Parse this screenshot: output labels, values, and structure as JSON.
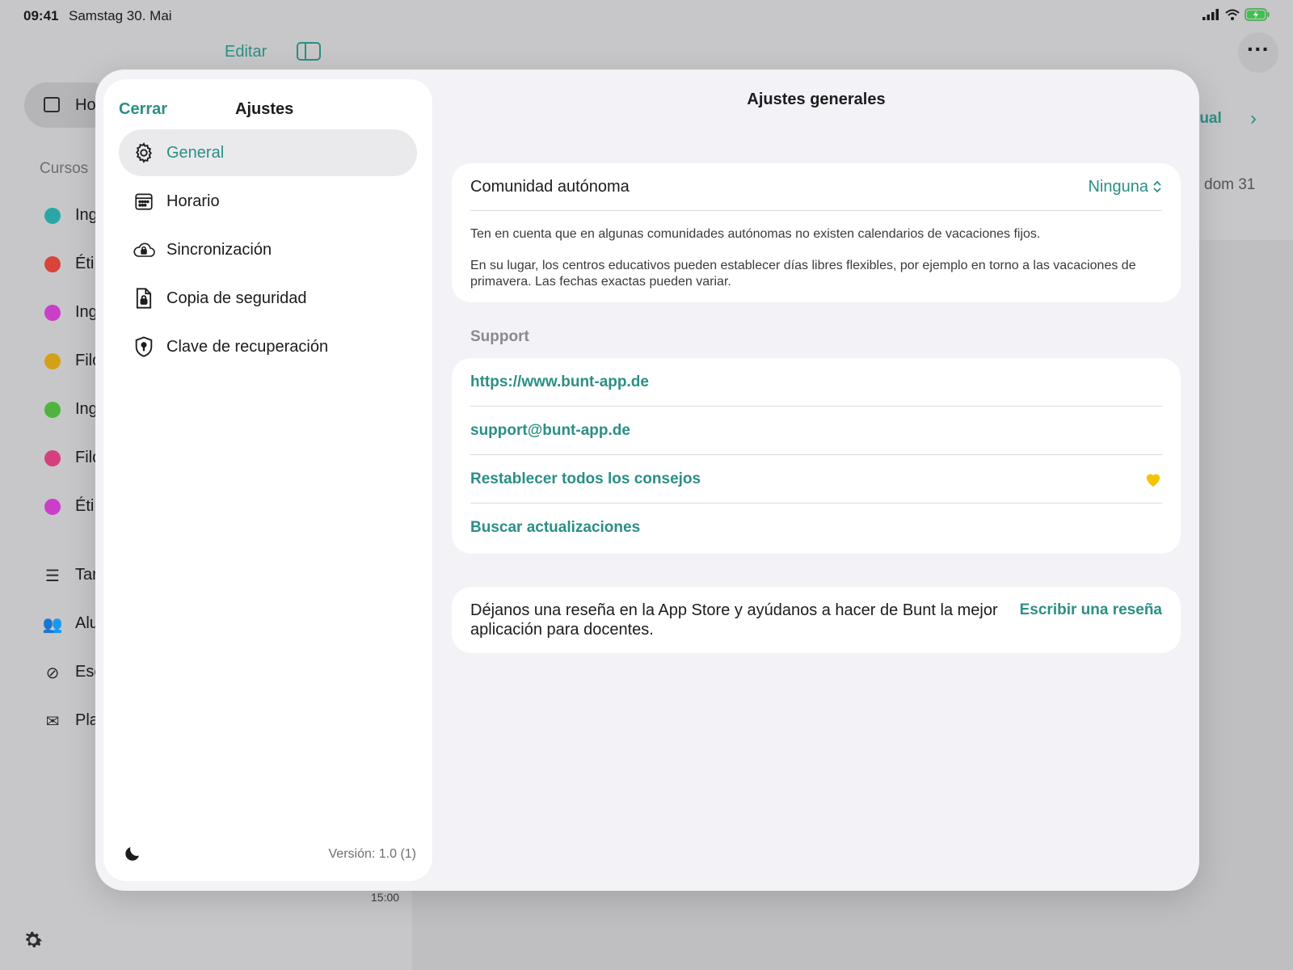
{
  "status_bar": {
    "time": "09:41",
    "date": "Samstag 30. Mai"
  },
  "background": {
    "edit_label": "Editar",
    "home_label": "Ho",
    "section_label": "Cursos",
    "courses": [
      {
        "label": "Ing",
        "color": "#2ba6a6"
      },
      {
        "label": "Éti",
        "color": "#d8443a"
      },
      {
        "label": "Ing",
        "color": "#c93fc9"
      },
      {
        "label": "Filo",
        "color": "#d4a018"
      },
      {
        "label": "Ing",
        "color": "#4fb33f"
      },
      {
        "label": "Filo",
        "color": "#d63f7d"
      },
      {
        "label": "Éti",
        "color": "#c93fc9"
      }
    ],
    "nav_items": [
      {
        "label": "Tar",
        "icon": "checklist-icon"
      },
      {
        "label": "Alu",
        "icon": "people-icon"
      },
      {
        "label": "Esc",
        "icon": "clock-slash-icon"
      },
      {
        "label": "Pla",
        "icon": "envelope-icon"
      }
    ],
    "actual_label": "tual",
    "day_label": "dom 31",
    "time_label": "15:00"
  },
  "settings": {
    "close_label": "Cerrar",
    "title": "Ajustes",
    "menu": [
      {
        "label": "General",
        "icon": "gear-icon",
        "active": true
      },
      {
        "label": "Horario",
        "icon": "calendar-icon",
        "active": false
      },
      {
        "label": "Sincronización",
        "icon": "cloud-lock-icon",
        "active": false
      },
      {
        "label": "Copia de seguridad",
        "icon": "doc-lock-icon",
        "active": false
      },
      {
        "label": "Clave de recuperación",
        "icon": "shield-key-icon",
        "active": false
      }
    ],
    "version": "Versión: 1.0 (1)"
  },
  "general": {
    "title": "Ajustes generales",
    "region_label": "Comunidad autónoma",
    "region_value": "Ninguna",
    "region_note_1": "Ten en cuenta que en algunas comunidades autónomas no existen calendarios de vacaciones fijos.",
    "region_note_2": "En su lugar, los centros educativos pueden establecer días libres flexibles, por ejemplo en torno a las vacaciones de primavera. Las fechas exactas pueden variar.",
    "support_header": "Support",
    "support_links": [
      "https://www.bunt-app.de",
      "support@bunt-app.de",
      "Restablecer todos los consejos",
      "Buscar actualizaciones"
    ],
    "review_text": "Déjanos una reseña en la App Store y ayúdanos a hacer de Bunt la mejor aplicación para docentes.",
    "review_button": "Escribir una reseña"
  },
  "colors": {
    "accent": "#2a8f86",
    "heart": "#f5c400"
  }
}
